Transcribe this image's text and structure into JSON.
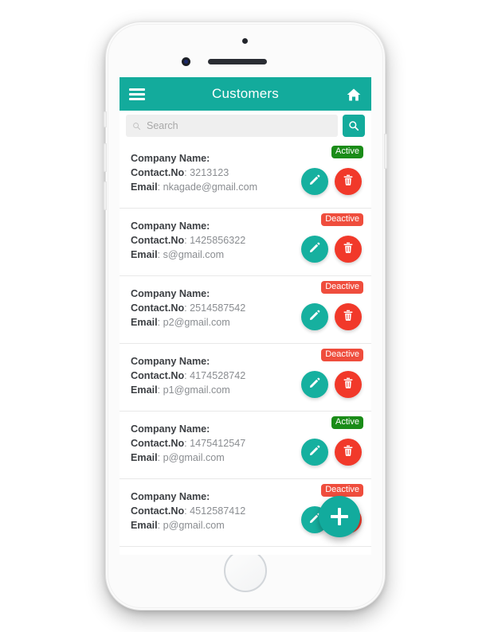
{
  "app": {
    "title": "Customers",
    "menu_icon": "hamburger-icon",
    "home_icon": "home-icon",
    "accent_color": "#13ab9c",
    "danger_color": "#f1392a",
    "active_color": "#1a8c18",
    "deactive_color": "#ef4d3d"
  },
  "search": {
    "placeholder": "Search",
    "value": "",
    "icon": "search-icon",
    "button_icon": "search-icon"
  },
  "labels": {
    "company": "Company Name:",
    "contact": "Contact.No",
    "email": "Email",
    "separator": ": "
  },
  "actions": {
    "edit_icon": "pencil-icon",
    "delete_icon": "trash-icon",
    "add_icon": "plus-icon"
  },
  "customers": [
    {
      "company": "",
      "contact": "3213123",
      "email": "nkagade@gmail.com",
      "status": "Active",
      "status_type": "active"
    },
    {
      "company": "",
      "contact": "1425856322",
      "email": "s@gmail.com",
      "status": "Deactive",
      "status_type": "deactive"
    },
    {
      "company": "",
      "contact": "2514587542",
      "email": "p2@gmail.com",
      "status": "Deactive",
      "status_type": "deactive"
    },
    {
      "company": "",
      "contact": "4174528742",
      "email": "p1@gmail.com",
      "status": "Deactive",
      "status_type": "deactive"
    },
    {
      "company": "",
      "contact": "1475412547",
      "email": "p@gmail.com",
      "status": "Active",
      "status_type": "active"
    },
    {
      "company": "",
      "contact": "4512587412",
      "email": "p@gmail.com",
      "status": "Deactive",
      "status_type": "deactive"
    }
  ]
}
